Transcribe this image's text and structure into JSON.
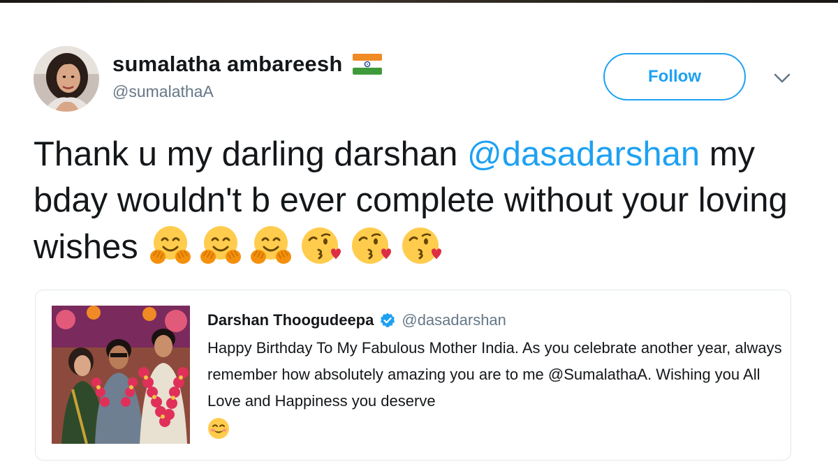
{
  "author": {
    "display_name": "sumalatha ambareesh",
    "handle": "@sumalathaA",
    "flag_icon": "india-flag-icon"
  },
  "follow": {
    "label": "Follow",
    "accent": "#1da1f2"
  },
  "tweet": {
    "text_part1": "Thank u my darling darshan ",
    "mention": "@dasadarshan",
    "text_part2": " my bday wouldn't b ever complete without your loving wishes",
    "emojis": [
      "hugging-face-emoji",
      "hugging-face-emoji",
      "hugging-face-emoji",
      "face-blowing-kiss-emoji",
      "face-blowing-kiss-emoji",
      "face-blowing-kiss-emoji"
    ]
  },
  "quoted_tweet": {
    "display_name": "Darshan Thoogudeepa",
    "handle": "@dasadarshan",
    "verified": true,
    "body": "Happy Birthday To My Fabulous Mother India. As you celebrate another year, always remember how absolutely amazing you are to me @SumalathaA. Wishing you All Love and Happiness you deserve",
    "trailing_emoji": "smiling-face-emoji"
  },
  "colors": {
    "text": "#14171a",
    "secondary_text": "#657786",
    "link": "#1da1f2",
    "border": "#e1e8ed"
  }
}
